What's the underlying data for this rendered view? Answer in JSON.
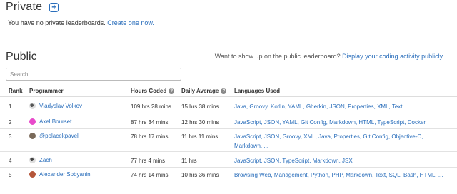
{
  "private": {
    "title": "Private",
    "add_icon": "plus-icon",
    "message": "You have no private leaderboards.",
    "create_link": "Create one now."
  },
  "public": {
    "title": "Public",
    "promo_text": "Want to show up on the public leaderboard?",
    "promo_link": "Display your coding activity publicly."
  },
  "search": {
    "placeholder": "Search..."
  },
  "columns": {
    "rank": "Rank",
    "programmer": "Programmer",
    "hours": "Hours Coded",
    "daily": "Daily Average",
    "languages": "Languages Used"
  },
  "rows": [
    {
      "rank": "1",
      "name": "Vladyslav Volkov",
      "hours": "109 hrs 28 mins",
      "daily": "15 hrs 38 mins",
      "languages": "Java, Groovy, Kotlin, YAML, Gherkin, JSON, Properties, XML, Text, ..."
    },
    {
      "rank": "2",
      "name": "Axel Bourset",
      "hours": "87 hrs 34 mins",
      "daily": "12 hrs 30 mins",
      "languages": "JavaScript, JSON, YAML, Git Config, Markdown, HTML, TypeScript, Docker"
    },
    {
      "rank": "3",
      "name": "@polacekpavel",
      "hours": "78 hrs 17 mins",
      "daily": "11 hrs 11 mins",
      "languages": "JavaScript, JSON, Groovy, XML, Java, Properties, Git Config, Objective-C, Markdown, ..."
    },
    {
      "rank": "4",
      "name": "Zach",
      "hours": "77 hrs 4 mins",
      "daily": "11 hrs",
      "languages": "JavaScript, JSON, TypeScript, Markdown, JSX"
    },
    {
      "rank": "5",
      "name": "Alexander Sobyanin",
      "hours": "74 hrs 14 mins",
      "daily": "10 hrs 36 mins",
      "languages": "Browsing Web, Management, Python, PHP, Markdown, Text, SQL, Bash, HTML, ..."
    }
  ],
  "colors": {
    "link": "#2a6ebb",
    "border": "#dddddd",
    "text": "#333333"
  }
}
